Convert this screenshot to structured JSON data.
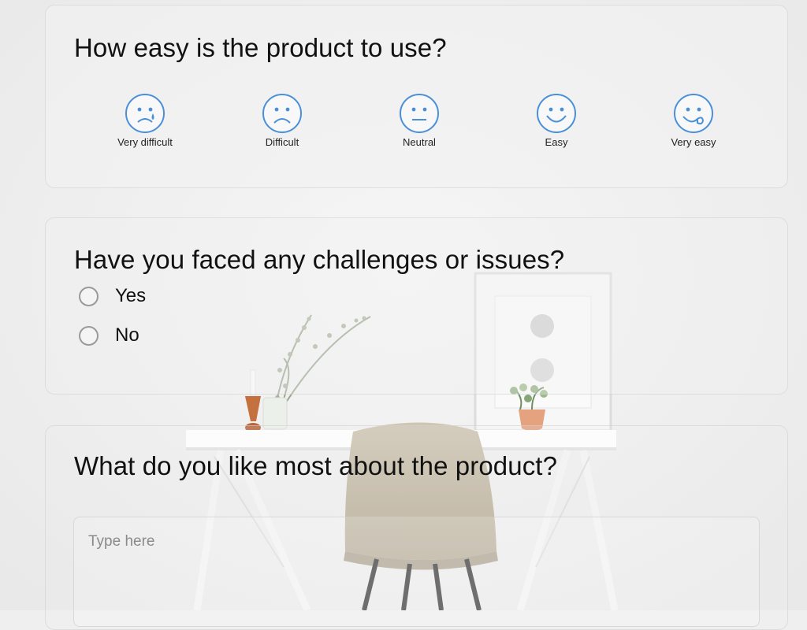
{
  "questions": [
    {
      "title": "How easy is the product to use?",
      "type": "rating",
      "options": [
        {
          "label": "Very difficult",
          "icon": "very-difficult-face-icon"
        },
        {
          "label": "Difficult",
          "icon": "sad-face-icon"
        },
        {
          "label": "Neutral",
          "icon": "neutral-face-icon"
        },
        {
          "label": "Easy",
          "icon": "smile-face-icon"
        },
        {
          "label": "Very easy",
          "icon": "tongue-face-icon"
        }
      ]
    },
    {
      "title": "Have you faced any challenges or issues?",
      "type": "radio",
      "options": [
        "Yes",
        "No"
      ]
    },
    {
      "title": "What do you like most about the product?",
      "type": "text",
      "placeholder": "Type here"
    }
  ],
  "colors": {
    "icon_accent": "#4a90d9",
    "question_text": "#111111",
    "card_border": "#d8d8d8"
  }
}
